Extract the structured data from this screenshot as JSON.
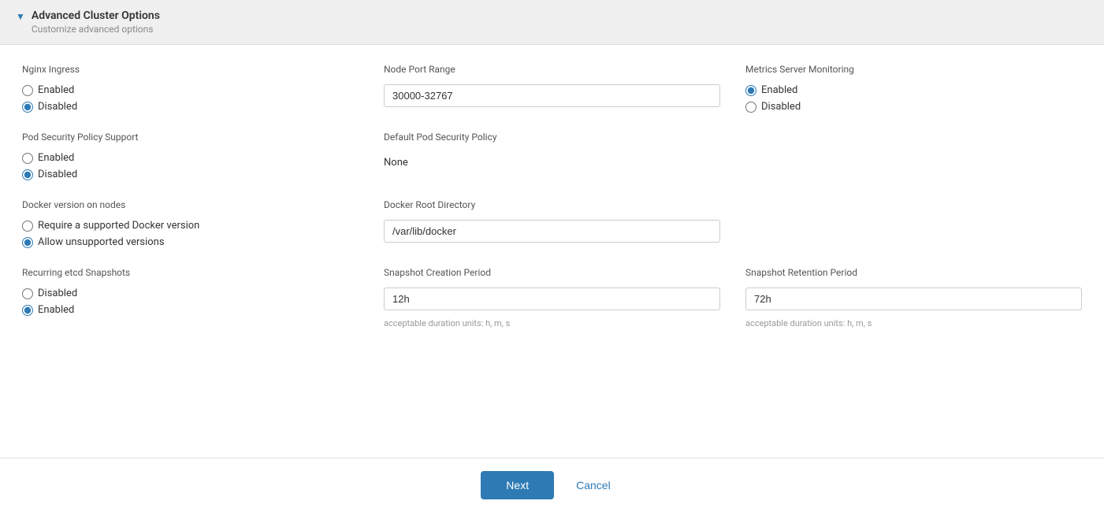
{
  "header": {
    "title": "Advanced Cluster Options",
    "subtitle": "Customize advanced options",
    "arrow": "▼"
  },
  "sections": {
    "nginxIngress": {
      "label": "Nginx Ingress",
      "options": [
        {
          "label": "Enabled",
          "value": "enabled",
          "checked": false
        },
        {
          "label": "Disabled",
          "value": "disabled",
          "checked": true
        }
      ]
    },
    "nodePortRange": {
      "label": "Node Port Range",
      "value": "30000-32767",
      "placeholder": "30000-32767"
    },
    "metricsServer": {
      "label": "Metrics Server Monitoring",
      "options": [
        {
          "label": "Enabled",
          "value": "enabled",
          "checked": true
        },
        {
          "label": "Disabled",
          "value": "disabled",
          "checked": false
        }
      ]
    },
    "podSecurityPolicy": {
      "label": "Pod Security Policy Support",
      "options": [
        {
          "label": "Enabled",
          "value": "enabled",
          "checked": false
        },
        {
          "label": "Disabled",
          "value": "disabled",
          "checked": true
        }
      ]
    },
    "defaultPodSecurityPolicy": {
      "label": "Default Pod Security Policy",
      "value": "None"
    },
    "dockerVersion": {
      "label": "Docker version on nodes",
      "options": [
        {
          "label": "Require a supported Docker version",
          "value": "require",
          "checked": false
        },
        {
          "label": "Allow unsupported versions",
          "value": "allow",
          "checked": true
        }
      ]
    },
    "dockerRootDir": {
      "label": "Docker Root Directory",
      "value": "/var/lib/docker",
      "placeholder": "/var/lib/docker"
    },
    "recurringSnapshots": {
      "label": "Recurring etcd Snapshots",
      "options": [
        {
          "label": "Disabled",
          "value": "disabled",
          "checked": false
        },
        {
          "label": "Enabled",
          "value": "enabled",
          "checked": true
        }
      ]
    },
    "snapshotCreation": {
      "label": "Snapshot Creation Period",
      "value": "12h",
      "hint": "acceptable duration units: h, m, s"
    },
    "snapshotRetention": {
      "label": "Snapshot Retention Period",
      "value": "72h",
      "hint": "acceptable duration units: h, m, s"
    }
  },
  "footer": {
    "next_label": "Next",
    "cancel_label": "Cancel"
  }
}
